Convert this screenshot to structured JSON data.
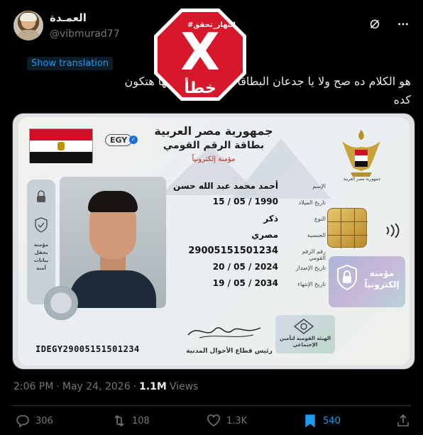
{
  "author": {
    "display_name": "العمـدة",
    "handle": "@vibmurad77"
  },
  "translate_link": "Show translation",
  "tweet_text": "هو الكلام ده صح ولا يا جدعان البطاقات الشخصية كلها هتكون كده",
  "overlay": {
    "label": "#النهار_تحقق",
    "symbol": "X",
    "verdict": "خطأ",
    "color": "#d7182a"
  },
  "id_card": {
    "country_code": "EGY",
    "title_country": "جمهورية مصر العربية",
    "title_card": "بطاقة الرقم القومي",
    "title_secured": "مؤمنة إلكترونياً",
    "coat_label": "جمهورية مصر العربية",
    "side_text": [
      "مؤمنة",
      "بحقل",
      "بيانات",
      "آمنة"
    ],
    "fields": [
      {
        "label": "الإسم",
        "value": "أحمد محمد عبد الله حسن"
      },
      {
        "label": "تاريخ الميلاد",
        "value": "15 / 05 / 1990"
      },
      {
        "label": "النوع",
        "value": "ذكر"
      },
      {
        "label": "الجنسية",
        "value": "مصري"
      },
      {
        "label": "رقم الرقم القومي",
        "value": "29005151501234"
      },
      {
        "label": "تاريخ الإصدار",
        "value": "20 / 05 / 2024"
      },
      {
        "label": "تاريخ الإنتهاء",
        "value": "19 / 05 / 2034"
      }
    ],
    "lock_text": [
      "مؤمنة",
      "إلكترونياً"
    ],
    "signature_label": "رئيس قطاع الأحوال المدنية",
    "mrz": "IDEGY29005151501234",
    "hologram_text": [
      "الهيئة القومية لتأمين",
      "الإجتماعي"
    ]
  },
  "meta": {
    "time": "2:06 PM",
    "separator": "·",
    "date": "May 24, 2026",
    "views_count": "1.1M",
    "views_label": "Views"
  },
  "actions": {
    "replies": "306",
    "reposts": "108",
    "likes": "1.3K",
    "bookmarks": "540"
  },
  "colors": {
    "accent": "#1d9bf0",
    "muted": "#71767b",
    "background": "#000000"
  }
}
